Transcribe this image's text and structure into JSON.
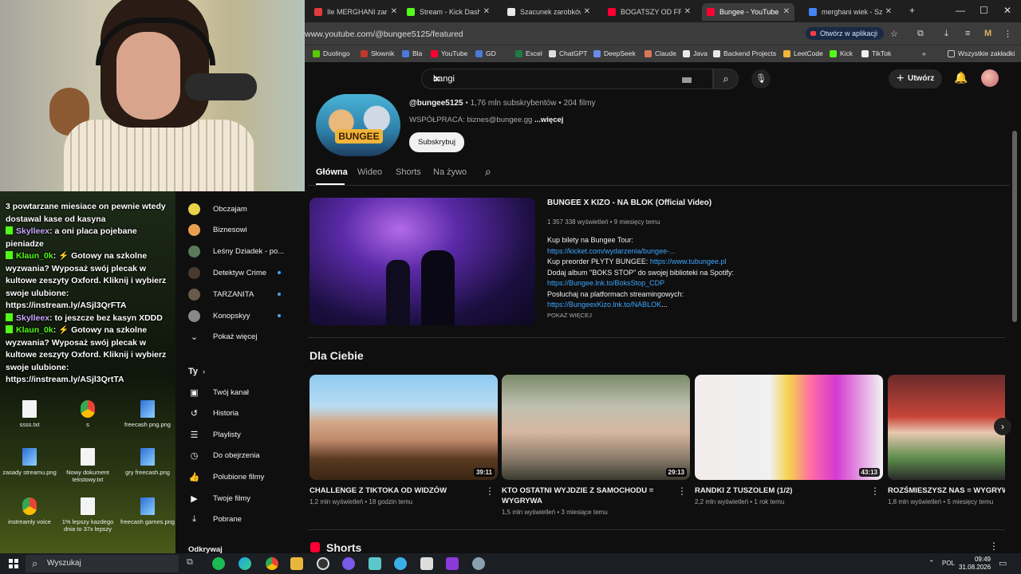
{
  "browser": {
    "tabs": [
      {
        "label": "Ile MERGHANI zarabia",
        "color": "#e23b3b",
        "active": false
      },
      {
        "label": "Stream - Kick Dashboard",
        "color": "#53fc18",
        "active": false
      },
      {
        "label": "Szacunek zarobków Streamer",
        "color": "#e9e9e9",
        "active": false
      },
      {
        "label": "BOGATSZY OD FRIZA?",
        "color": "#ff0033",
        "active": false
      },
      {
        "label": "Bungee - YouTube",
        "color": "#ff0033",
        "active": true
      },
      {
        "label": "merghani wiek - Szukaj",
        "color": "#4285f4",
        "active": false
      }
    ],
    "new_tab": "+",
    "url": "www.youtube.com/@bungee5125/featured",
    "open_in_app": "Otwórz w aplikacji",
    "bookmarks": [
      "Duolingo",
      "Słownik",
      "Bla",
      "YouTube",
      "GD",
      "Excel",
      "ChatGPT",
      "DeepSeek",
      "Claude",
      "Java",
      "Backend Projects",
      "LeetCode",
      "Kick",
      "TikTok"
    ],
    "all_bookmarks": "Wszystkie zakładki"
  },
  "youtube": {
    "search_value": "bangi",
    "create_label": "Utwórz",
    "channel": {
      "handle": "@bungee5125",
      "stats": " • 1,76 mln subskrybentów • 204 filmy",
      "about": "WSPÓŁPRACA: biznes@bungee.gg ",
      "more": "...więcej",
      "subscribe": "Subskrybuj",
      "logo_text": "BUNGEE"
    },
    "tabs": [
      "Główna",
      "Wideo",
      "Shorts",
      "Na żywo"
    ],
    "featured": {
      "title": "BUNGEE X KIZO - NA BLOK (Official Video)",
      "meta": "1 357 338 wyświetleń • 9 miesięcy temu",
      "lines": [
        {
          "text": "Kup bilety na Bungee Tour:",
          "link": ""
        },
        {
          "text": "",
          "link": "https://kicket.com/wydarzenia/bungee-..."
        },
        {
          "text": "Kup preorder PŁYTY BUNGEE: ",
          "link": "https://www.tubungee.pl"
        },
        {
          "text": "Dodaj album \"BOKS STOP\" do swojej biblioteki na Spotify:",
          "link": ""
        },
        {
          "text": "",
          "link": "https://Bungee.lnk.to/BoksStop_CDP"
        },
        {
          "text": "Posłuchaj na platformach streamingowych:",
          "link": ""
        },
        {
          "text": "",
          "link": "https://BungeexKizo.lnk.to/NABLOK",
          "tail": "..."
        }
      ],
      "show_more": "POKAŻ WIĘCEJ"
    },
    "section_title": "Dla Ciebie",
    "videos": [
      {
        "title": "CHALLENGE Z TIKTOKA OD WIDZÓW",
        "views": "1,2 mln wyświetleń",
        "age": "18 godzin temu",
        "duration": "39:11"
      },
      {
        "title": "KTO OSTATNI WYJDZIE Z SAMOCHODU = WYGRYWA",
        "views": "1,5 mln wyświetleń",
        "age": "3 miesiące temu",
        "duration": "29:13"
      },
      {
        "title": "RANDKI Z TUSZOLEM (1/2)",
        "views": "2,2 mln wyświetleń",
        "age": "1 rok temu",
        "duration": "43:13"
      },
      {
        "title": "ROZŚMIESZYSZ NAS = WYGRYWASZ",
        "views": "1,8 mln wyświetleń",
        "age": "5 miesięcy temu",
        "duration": ""
      }
    ],
    "shorts_title": "Shorts",
    "sidebar": {
      "subs": [
        {
          "label": "Obczajam",
          "color": "#e8d24a",
          "dot": false
        },
        {
          "label": "Biznesowi",
          "color": "#e8a050",
          "dot": false
        },
        {
          "label": "Leśny Dziadek - po...",
          "color": "#5a7a5a",
          "dot": false
        },
        {
          "label": "Detektyw Crime",
          "color": "#4a3a30",
          "dot": true
        },
        {
          "label": "TARZANITA",
          "color": "#6a5a4a",
          "dot": true
        },
        {
          "label": "Konopskyy",
          "color": "#888",
          "dot": true
        }
      ],
      "show_more": "Pokaż więcej",
      "you_header": "Ty",
      "you_items": [
        {
          "label": "Twój kanał",
          "icon": "▣"
        },
        {
          "label": "Historia",
          "icon": "↺"
        },
        {
          "label": "Playlisty",
          "icon": "☰"
        },
        {
          "label": "Do obejrzenia",
          "icon": "◷"
        },
        {
          "label": "Polubione filmy",
          "icon": "👍"
        },
        {
          "label": "Twoje filmy",
          "icon": "▶"
        },
        {
          "label": "Pobrane",
          "icon": "⤓"
        }
      ],
      "cut_label": "Odkrywaj"
    }
  },
  "chat": [
    {
      "kind": "text",
      "text": "3 powtarzane miesiace on pewnie wtedy"
    },
    {
      "kind": "text",
      "text": "dostawal kase od kasyna"
    },
    {
      "kind": "msg",
      "user": "Skylleex",
      "text": " a oni placa pojebane",
      "color": "#c9a6ff"
    },
    {
      "kind": "text",
      "text": "pieniadze"
    },
    {
      "kind": "msg",
      "user": "Klaun_0k",
      "text": " ⚡ Gotowy na szkolne",
      "color": "#53fc18"
    },
    {
      "kind": "text",
      "text": "wyzwania? Wyposaż swój plecak w"
    },
    {
      "kind": "text",
      "text": "kultowe zeszyty Oxford. Kliknij i wybierz"
    },
    {
      "kind": "text",
      "text": "swoje ulubione:"
    },
    {
      "kind": "text",
      "text": "https://instream.ly/ASjl3QrFTA"
    },
    {
      "kind": "msg",
      "user": "Skylleex",
      "text": " to jeszcze bez kasyn XDDD",
      "color": "#c9a6ff"
    },
    {
      "kind": "msg",
      "user": "Klaun_0k",
      "text": " ⚡ Gotowy na szkolne",
      "color": "#53fc18"
    },
    {
      "kind": "text",
      "text": "wyzwania? Wyposaż swój plecak w"
    },
    {
      "kind": "text",
      "text": "kultowe zeszyty Oxford. Kliknij i wybierz"
    },
    {
      "kind": "text",
      "text": "swoje ulubione:"
    },
    {
      "kind": "text",
      "text": "https://instream.ly/ASjl3QrtTA"
    }
  ],
  "desktop_icons": [
    {
      "label": "ssss.txt",
      "type": "file"
    },
    {
      "label": "s",
      "type": "chrome"
    },
    {
      "label": "freecash png.png",
      "type": "img"
    },
    {
      "label": "zasady streamu.png",
      "type": "img"
    },
    {
      "label": "Nowy dokument tekstowy.txt",
      "type": "file"
    },
    {
      "label": "gry freecash.png",
      "type": "img"
    },
    {
      "label": "instreamly voice",
      "type": "chrome"
    },
    {
      "label": "1% lepszy kazdego dnia to 37x lepszy",
      "type": "file"
    },
    {
      "label": "freecash games.png",
      "type": "img"
    }
  ],
  "taskbar": {
    "search": "Wyszukaj",
    "lang": "POL",
    "time": "09:49",
    "date": "31.08.2026"
  }
}
